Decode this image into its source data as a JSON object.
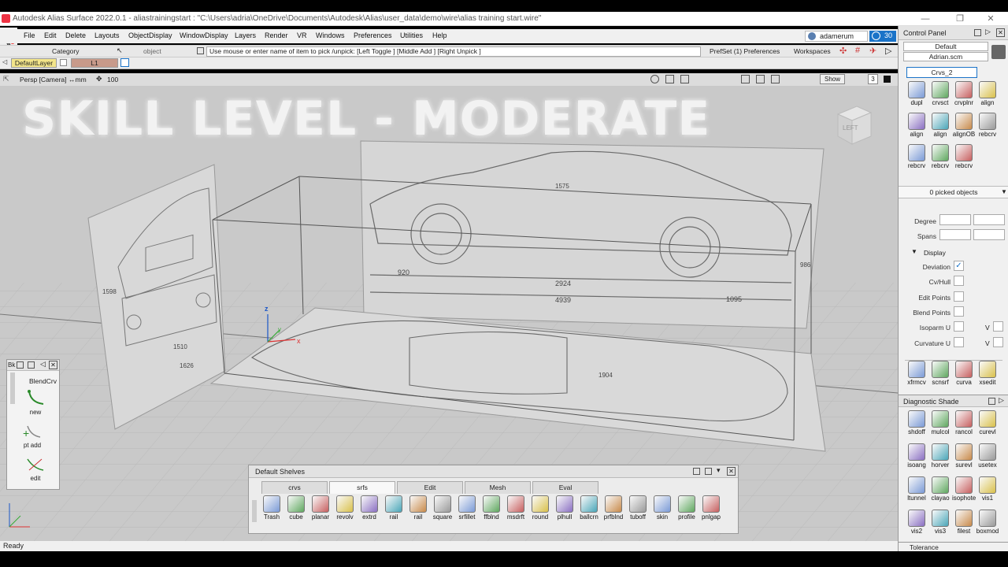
{
  "window": {
    "title": "Autodesk Alias Surface 2022.0.1   - aliastrainingstart : \"C:\\Users\\adria\\OneDrive\\Documents\\Autodesk\\Alias\\user_data\\demo\\wire\\alias training start.wire\"",
    "minimize": "—",
    "maximize": "❐",
    "close": "✕"
  },
  "menubar": {
    "items": [
      "File",
      "Edit",
      "Delete",
      "Layouts",
      "ObjectDisplay",
      "WindowDisplay",
      "Layers",
      "Render",
      "VR",
      "Windows",
      "Preferences",
      "Utilities",
      "Help"
    ],
    "user": "adamerum",
    "badge": "30"
  },
  "toolrow": {
    "mode": "object",
    "category": "Category",
    "object": "object",
    "prompt": "Use mouse or enter name of item to pick /unpick: [Left Toggle ] [Middle Add ] [Right Unpick ]",
    "prefset": "PrefSet (1) Preferences",
    "workspaces": "Workspaces"
  },
  "layers": {
    "default": "DefaultLayer",
    "l1": "L1"
  },
  "viewbar": {
    "camera": "Persp [Camera]",
    "units": "↔mm",
    "zoom": "100",
    "show": "Show",
    "count": "3"
  },
  "overlay": {
    "headline": "SKILL LEVEL - MODERATE"
  },
  "viewcube": {
    "face": "LEFT"
  },
  "drawing": {
    "dims": [
      "920",
      "2924",
      "4939",
      "1095",
      "1510",
      "1626",
      "1598",
      "1575",
      "986",
      "1904"
    ],
    "axis_z": "z",
    "axis_y": "y",
    "axis_x": "x"
  },
  "blend_panel": {
    "title": "Bk",
    "heading": "BlendCrv",
    "items": [
      "new",
      "pt add",
      "edit"
    ]
  },
  "shelves": {
    "title": "Default Shelves",
    "tabs": [
      "crvs",
      "srfs",
      "Edit",
      "Mesh",
      "Eval"
    ],
    "active_tab": "srfs",
    "tools": [
      "Trash",
      "cube",
      "planar",
      "revolv",
      "extrd",
      "rail",
      "rail",
      "square",
      "srfillet",
      "ffblnd",
      "msdrft",
      "round",
      "plhull",
      "ballcrn",
      "prfblnd",
      "tuboff",
      "skin",
      "profile",
      "pnlgap"
    ]
  },
  "control_panel": {
    "title": "Control Panel",
    "preset": "Default",
    "file": "Adrian.scm",
    "shelf_title": "Crvs_2",
    "curve_tools": [
      "dupl",
      "crvsct",
      "crvplnr",
      "align",
      "align",
      "align",
      "alignOB",
      "rebcrv",
      "rebcrv",
      "rebcrv",
      "rebcrv"
    ],
    "picked": "0 picked objects",
    "degree_label": "Degree",
    "spans_label": "Spans",
    "display_label": "Display",
    "display_rows": [
      "Deviation",
      "Cv/Hull",
      "Edit Points",
      "Blend Points",
      "Isoparm U",
      "Curvature U"
    ],
    "v_label": "V",
    "deviation_checked": true,
    "analysis_tools": [
      "xfrmcv",
      "scnsrf",
      "curva",
      "xsedit"
    ],
    "diag_title": "Diagnostic Shade",
    "diag_tools": [
      "shdoff",
      "mulcol",
      "rancol",
      "curevl",
      "isoang",
      "horver",
      "surevl",
      "usetex",
      "ltunnel",
      "clayao",
      "isophote",
      "vis1",
      "vis2",
      "vis3",
      "filest",
      "boxmod"
    ],
    "tolerance": "Tolerance"
  },
  "status": {
    "text": "Ready"
  },
  "colors": {
    "viewport": "#c9c9c9",
    "accent": "#1a73c8",
    "layer_active": "#f3e58a",
    "layer_l1": "#c89a8a"
  }
}
